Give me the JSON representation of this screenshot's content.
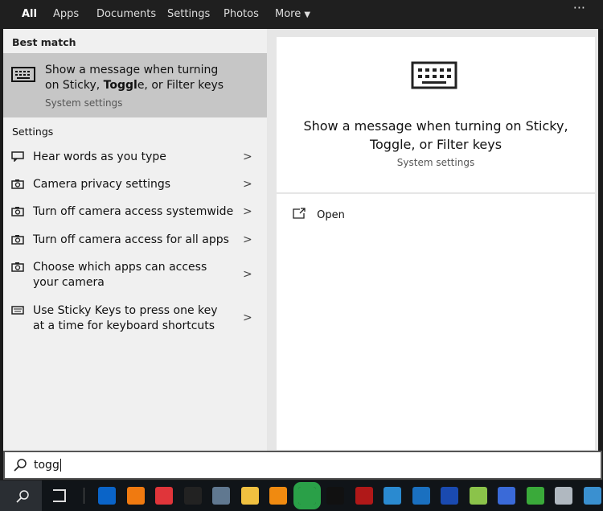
{
  "tabs": [
    {
      "label": "All",
      "active": true
    },
    {
      "label": "Apps"
    },
    {
      "label": "Documents"
    },
    {
      "label": "Settings"
    },
    {
      "label": "Photos"
    },
    {
      "label": "More"
    }
  ],
  "more_menu_icon": "ellipsis-icon",
  "best_match": {
    "header": "Best match",
    "title_pre": "Show a message when turning on Sticky, ",
    "title_bold": "Toggl",
    "title_post": "e, or Filter keys",
    "subtitle": "System settings",
    "icon": "keyboard-icon"
  },
  "settings": {
    "header": "Settings",
    "items": [
      {
        "label": "Hear words as you type",
        "icon": "speech-icon"
      },
      {
        "label": "Camera privacy settings",
        "icon": "camera-icon"
      },
      {
        "label": "Turn off camera access systemwide",
        "icon": "camera-icon"
      },
      {
        "label": "Turn off camera access for all apps",
        "icon": "camera-icon"
      },
      {
        "label": "Choose which apps can access your camera",
        "icon": "camera-icon"
      },
      {
        "label": "Use Sticky Keys to press one key at a time for keyboard shortcuts",
        "icon": "keyboard-icon"
      }
    ]
  },
  "preview": {
    "title": "Show a message when turning on Sticky, Toggle, or Filter keys",
    "subtitle": "System settings",
    "open_label": "Open"
  },
  "search": {
    "value": "togg"
  },
  "taskbar": {
    "apps": [
      "outlook",
      "search-app",
      "vivaldi",
      "terminal",
      "calculator",
      "file-explorer",
      "vlc",
      "app-green",
      "app-b",
      "app-red",
      "app-blue",
      "app-window",
      "app-sync",
      "bluestacks",
      "app-s",
      "app-green2",
      "app-chart",
      "app-contacts"
    ],
    "colors": [
      "#0a64c8",
      "#f07a10",
      "#e0353a",
      "#222",
      "#607890",
      "#f0c040",
      "#f08a10",
      "#2aa048",
      "#111",
      "#b01818",
      "#2a8ad0",
      "#1a70c0",
      "#1a4ab0",
      "#8bc34a",
      "#3a6ad8",
      "#3aaa3a",
      "#b0b8c0",
      "#3a90d0"
    ]
  }
}
